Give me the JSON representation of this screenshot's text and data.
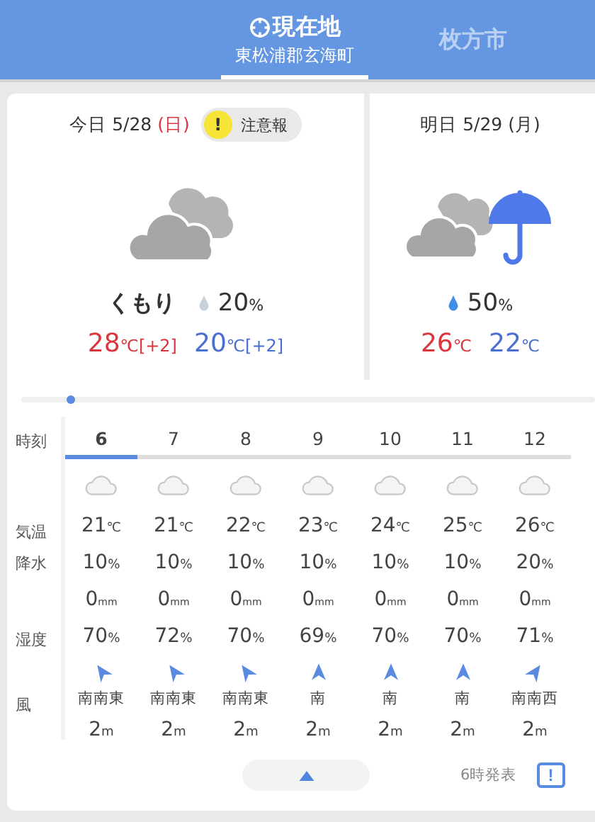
{
  "header": {
    "tabs": [
      {
        "label": "現在地",
        "sublabel": "東松浦郡玄海町",
        "kind": "location",
        "selected": true
      },
      {
        "label": "枚方市",
        "kind": "city",
        "selected": false
      }
    ]
  },
  "days": [
    {
      "kind": "cloudy",
      "label": "今日",
      "date": "5/28",
      "weekday": "(日)",
      "holiday": true,
      "warning": "注意報",
      "warning_icon": "!",
      "condition": "くもり",
      "precip": "20",
      "precip_unit": "%",
      "high": "28",
      "high_unit": "℃",
      "low": "20",
      "low_unit": "℃",
      "high_diff": "[+2]",
      "low_diff": "[+2]"
    },
    {
      "kind": "cloudy-rain",
      "label": "明日",
      "date": "5/29",
      "weekday": "(月)",
      "holiday": false,
      "precip": "50",
      "precip_unit": "%",
      "high": "26",
      "high_unit": "℃",
      "low": "22",
      "low_unit": "℃"
    }
  ],
  "hourly": {
    "labels": {
      "time": "時刻",
      "temp": "気温",
      "precip": "降水",
      "humidity": "湿度",
      "wind": "風"
    },
    "hours": [
      {
        "hour": "6",
        "selected": true,
        "temp": "21",
        "temp_unit": "℃",
        "precip": "10",
        "precip_unit": "%",
        "rain": "0",
        "rain_unit": "mm",
        "humidity": "70",
        "humidity_unit": "%",
        "wind_arrow": {
          "kind": "sse"
        },
        "wind_dir": "南南東",
        "wind_speed": "2",
        "speed_unit": "m"
      },
      {
        "hour": "7",
        "selected": false,
        "temp": "21",
        "temp_unit": "℃",
        "precip": "10",
        "precip_unit": "%",
        "rain": "0",
        "rain_unit": "mm",
        "humidity": "72",
        "humidity_unit": "%",
        "wind_arrow": {
          "kind": "sse"
        },
        "wind_dir": "南南東",
        "wind_speed": "2",
        "speed_unit": "m"
      },
      {
        "hour": "8",
        "selected": false,
        "temp": "22",
        "temp_unit": "℃",
        "precip": "10",
        "precip_unit": "%",
        "rain": "0",
        "rain_unit": "mm",
        "humidity": "70",
        "humidity_unit": "%",
        "wind_arrow": {
          "kind": "sse"
        },
        "wind_dir": "南南東",
        "wind_speed": "2",
        "speed_unit": "m"
      },
      {
        "hour": "9",
        "selected": false,
        "temp": "23",
        "temp_unit": "℃",
        "precip": "10",
        "precip_unit": "%",
        "rain": "0",
        "rain_unit": "mm",
        "humidity": "69",
        "humidity_unit": "%",
        "wind_arrow": {
          "kind": "s"
        },
        "wind_dir": "南",
        "wind_speed": "2",
        "speed_unit": "m"
      },
      {
        "hour": "10",
        "selected": false,
        "temp": "24",
        "temp_unit": "℃",
        "precip": "10",
        "precip_unit": "%",
        "rain": "0",
        "rain_unit": "mm",
        "humidity": "70",
        "humidity_unit": "%",
        "wind_arrow": {
          "kind": "s"
        },
        "wind_dir": "南",
        "wind_speed": "2",
        "speed_unit": "m"
      },
      {
        "hour": "11",
        "selected": false,
        "temp": "25",
        "temp_unit": "℃",
        "precip": "10",
        "precip_unit": "%",
        "rain": "0",
        "rain_unit": "mm",
        "humidity": "70",
        "humidity_unit": "%",
        "wind_arrow": {
          "kind": "s"
        },
        "wind_dir": "南",
        "wind_speed": "2",
        "speed_unit": "m"
      },
      {
        "hour": "12",
        "selected": false,
        "temp": "26",
        "temp_unit": "℃",
        "precip": "20",
        "precip_unit": "%",
        "rain": "0",
        "rain_unit": "mm",
        "humidity": "71",
        "humidity_unit": "%",
        "wind_arrow": {
          "kind": "ssw"
        },
        "wind_dir": "南南西",
        "wind_speed": "2",
        "speed_unit": "m"
      }
    ]
  },
  "footer": {
    "announced": "6時発表",
    "feedback_icon": "!"
  }
}
